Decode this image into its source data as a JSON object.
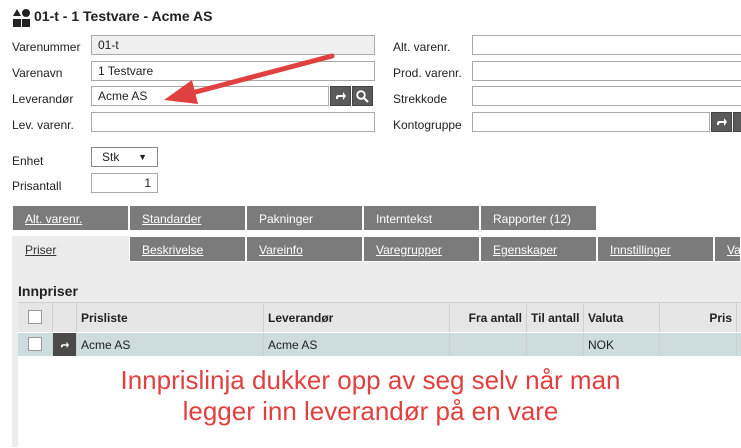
{
  "header": {
    "title": "01-t - 1 Testvare - Acme AS",
    "icon": "shapes-icon"
  },
  "form": {
    "varenummer": {
      "label": "Varenummer",
      "value": "01-t"
    },
    "varenavn": {
      "label": "Varenavn",
      "value": "1 Testvare"
    },
    "leverandor": {
      "label": "Leverandør",
      "value": "Acme AS"
    },
    "lev_varenr": {
      "label": "Lev. varenr.",
      "value": ""
    },
    "alt_varenr": {
      "label": "Alt. varenr.",
      "value": ""
    },
    "prod_varenr": {
      "label": "Prod. varenr.",
      "value": ""
    },
    "strekkode": {
      "label": "Strekkode",
      "value": ""
    },
    "kontogruppe": {
      "label": "Kontogruppe",
      "value": ""
    },
    "enhet": {
      "label": "Enhet",
      "value": "Stk"
    },
    "prisantall": {
      "label": "Prisantall",
      "value": "1"
    }
  },
  "tabs_row1": [
    {
      "label": "Alt. varenr."
    },
    {
      "label": "Standarder"
    },
    {
      "label": "Pakninger"
    },
    {
      "label": "Interntekst"
    },
    {
      "label": "Rapporter (12)"
    }
  ],
  "tabs_row2": [
    {
      "label": "Priser",
      "active": true
    },
    {
      "label": "Beskrivelse"
    },
    {
      "label": "Vareinfo"
    },
    {
      "label": "Varegrupper"
    },
    {
      "label": "Egenskaper"
    },
    {
      "label": "Innstillinger"
    },
    {
      "label": "Va"
    }
  ],
  "innpriser": {
    "title": "Innpriser",
    "columns": [
      "Prisliste",
      "Leverandør",
      "Fra antall",
      "Til antall",
      "Valuta",
      "Pris"
    ],
    "rows": [
      {
        "prisliste": "Acme AS",
        "leverandor": "Acme AS",
        "fra_antall": "",
        "til_antall": "",
        "valuta": "NOK",
        "pris": ""
      }
    ]
  },
  "annotation": {
    "line1": "Innprislinja dukker opp av seg selv når man",
    "line2": "legger inn leverandør på en vare",
    "color": "#e0403f"
  }
}
